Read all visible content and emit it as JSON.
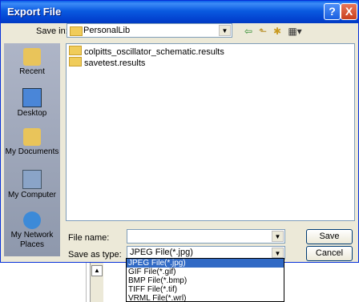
{
  "window": {
    "title": "Export File"
  },
  "titlebar_buttons": {
    "help": "?",
    "close": "X"
  },
  "save_in": {
    "label": "Save in:",
    "value": "PersonalLib"
  },
  "places": [
    {
      "label": "Recent",
      "icon": "recent-folder-icon"
    },
    {
      "label": "Desktop",
      "icon": "desktop-icon"
    },
    {
      "label": "My Documents",
      "icon": "my-documents-icon"
    },
    {
      "label": "My Computer",
      "icon": "my-computer-icon"
    },
    {
      "label": "My Network Places",
      "icon": "network-places-icon"
    }
  ],
  "files": [
    {
      "name": "colpitts_oscillator_schematic.results"
    },
    {
      "name": "savetest.results"
    }
  ],
  "file_name": {
    "label": "File name:",
    "value": ""
  },
  "save_as_type": {
    "label": "Save as type:",
    "value": "JPEG File(*.jpg)",
    "options": [
      "JPEG File(*.jpg)",
      "GIF File(*.gif)",
      "BMP File(*.bmp)",
      "TIFF File(*.tif)",
      "VRML File(*.wrl)"
    ]
  },
  "buttons": {
    "save": "Save",
    "cancel": "Cancel"
  },
  "colors": {
    "title_bar": "#0a5ae0",
    "dialog_bg": "#ece9d8",
    "places_bar": "#8e98ac",
    "selection": "#316ac5"
  }
}
